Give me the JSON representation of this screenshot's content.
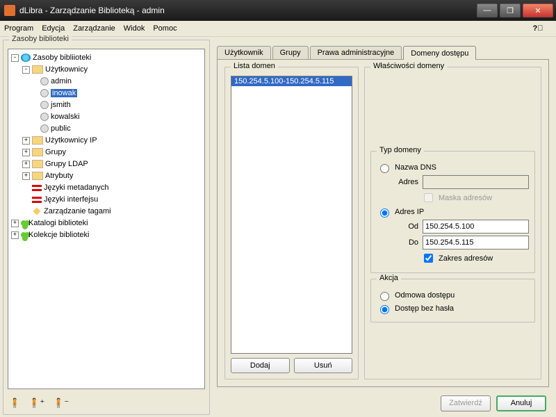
{
  "window": {
    "title": "dLibra - Zarządzanie Biblioteką - admin"
  },
  "menu": {
    "items": [
      "Program",
      "Edycja",
      "Zarządzanie",
      "Widok",
      "Pomoc"
    ]
  },
  "left_panel": {
    "title": "Zasoby biblioteki",
    "tree": {
      "root": "Zasoby bibliioteki",
      "uzytkownicy": "Użytkownicy",
      "users": [
        "admin",
        "inowak",
        "jsmith",
        "kowalski",
        "public"
      ],
      "uzytkownicy_ip": "Użytkownicy IP",
      "grupy": "Grupy",
      "grupy_ldap": "Grupy LDAP",
      "atrybuty": "Atrybuty",
      "jezyki_meta": "Języki metadanych",
      "jezyki_int": "Języki interfejsu",
      "tagi": "Zarządzanie tagami",
      "katalogi": "Katalogi biblioteki",
      "kolekcje": "Kolekcje biblioteki"
    }
  },
  "tabs": {
    "items": [
      "Użytkownik",
      "Grupy",
      "Prawa administracyjne",
      "Domeny dostępu"
    ],
    "active": 3
  },
  "domain_list": {
    "title": "Lista domen",
    "items": [
      "150.254.5.100-150.254.5.115"
    ],
    "add": "Dodaj",
    "remove": "Usuń"
  },
  "domain_props": {
    "title": "Właściwości domeny",
    "type": {
      "title": "Typ domeny",
      "dns_label": "Nazwa DNS",
      "addr_label": "Adres",
      "mask_label": "Maska adresów",
      "ip_label": "Adres IP",
      "from_label": "Od",
      "from_value": "150.254.5.100",
      "to_label": "Do",
      "to_value": "150.254.5.115",
      "range_label": "Zakres adresów"
    },
    "action": {
      "title": "Akcja",
      "deny": "Odmowa dostępu",
      "nopass": "Dostęp bez hasła"
    }
  },
  "footer": {
    "apply": "Zatwierdź",
    "cancel": "Anuluj"
  }
}
